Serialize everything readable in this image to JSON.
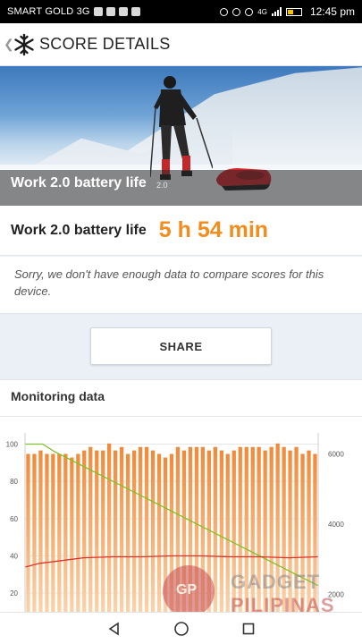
{
  "status_bar": {
    "carrier": "SMART GOLD 3G",
    "time": "12:45 pm",
    "network": "4G"
  },
  "app_bar": {
    "title": "SCORE DETAILS",
    "logo_icon": "snowflake-icon",
    "back_icon": "chevron-left-icon"
  },
  "hero": {
    "caption": "Work 2.0 battery life",
    "version": "2.0"
  },
  "result": {
    "label": "Work 2.0 battery life",
    "value": "5 h 54 min"
  },
  "note": {
    "text": "Sorry, we don't have enough data to compare scores for this device."
  },
  "share": {
    "label": "SHARE"
  },
  "monitoring": {
    "heading": "Monitoring data"
  },
  "watermark": {
    "text_line1": "GADGET",
    "text_line2": "PILIPINAS",
    "badge": "GP"
  },
  "colors": {
    "accent_orange": "#f28c1c",
    "battery_line": "#7ec22a",
    "temp_line": "#d9342b",
    "bar_top": "#f08a3a",
    "bar_bottom": "#fbd2a8"
  },
  "chart_data": {
    "type": "bar",
    "left_axis": {
      "ticks": [
        20,
        40,
        60,
        80,
        100
      ],
      "ylim": [
        10,
        106
      ]
    },
    "right_axis": {
      "ticks": [
        2000,
        4000,
        6000
      ],
      "ylim": [
        1500,
        6600
      ]
    },
    "bars_right_axis": [
      6000,
      6000,
      6100,
      6000,
      6000,
      6000,
      6000,
      5900,
      6000,
      6100,
      6200,
      6100,
      6100,
      6300,
      6100,
      6200,
      6000,
      6100,
      6200,
      6200,
      6100,
      6000,
      5900,
      6000,
      6200,
      6100,
      6200,
      6200,
      6200,
      6100,
      6200,
      6100,
      6000,
      6100,
      6200,
      6200,
      6200,
      6200,
      6100,
      6200,
      6300,
      6200,
      6100,
      6200,
      6000,
      6100,
      6000
    ],
    "series": [
      {
        "axis": "left",
        "color": "#7ec22a",
        "x": [
          0,
          6,
          10,
          20,
          30,
          40,
          50,
          60,
          70,
          80,
          90,
          100
        ],
        "values": [
          100,
          100,
          96,
          88,
          80,
          72,
          64,
          56,
          48,
          40,
          32,
          24
        ]
      },
      {
        "axis": "left",
        "color": "#d9342b",
        "x": [
          0,
          5,
          10,
          15,
          20,
          30,
          40,
          50,
          60,
          70,
          80,
          90,
          100
        ],
        "values": [
          34,
          36,
          37,
          38,
          39,
          39.5,
          39.5,
          40,
          40,
          39.5,
          39.5,
          39,
          39.5
        ]
      }
    ]
  }
}
